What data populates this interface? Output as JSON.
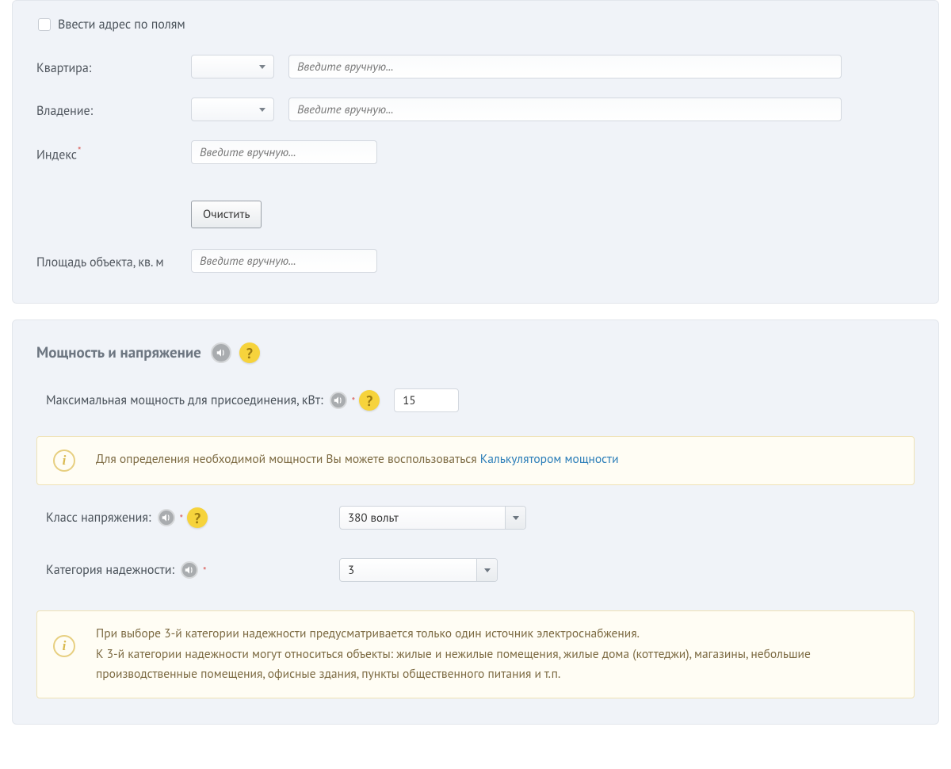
{
  "addressSection": {
    "checkboxLabel": "Ввести адрес по полям",
    "apartmentLabel": "Квартира:",
    "ownershipLabel": "Владение:",
    "indexLabel": "Индекс",
    "areaLabel": "Площадь объекта, кв. м",
    "manualPlaceholder": "Введите вручную...",
    "clearButton": "Очистить"
  },
  "powerSection": {
    "title": "Мощность и напряжение",
    "maxPowerLabel": "Максимальная мощность для присоединения, кВт:",
    "maxPowerValue": "15",
    "infoCalcPrefix": "Для определения необходимой мощности Вы можете воспользоваться ",
    "infoCalcLink": "Калькулятором мощности",
    "voltageClassLabel": "Класс напряжения:",
    "voltageClassValue": "380 вольт",
    "reliabilityLabel": "Категория надежности:",
    "reliabilityValue": "3",
    "reliabilityInfoLine1": "При выборе 3-й категории надежности предусматривается только один источник электроснабжения.",
    "reliabilityInfoLine2": "К 3-й категории надежности могут относиться объекты: жилые и нежилые помещения, жилые дома (коттеджи), магазины, небольшие производственные помещения, офисные здания, пункты общественного питания и т.п."
  },
  "glyphs": {
    "question": "?",
    "info": "i"
  }
}
